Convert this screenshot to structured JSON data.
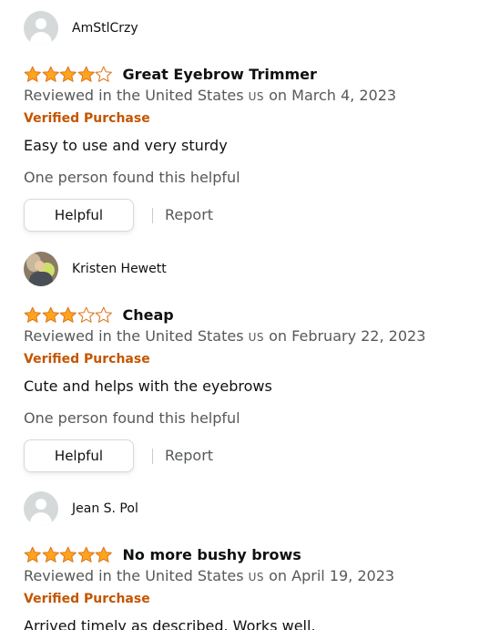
{
  "colors": {
    "star_fill": "#ffa41c",
    "star_outline": "#de7921",
    "verified": "#c45500",
    "secondary_text": "#565959",
    "primary_text": "#0f1111"
  },
  "reviews": [
    {
      "profile_name": "AmStlCrzy",
      "avatar": "default-avatar",
      "rating": 4,
      "title": "Great Eyebrow Trimmer",
      "date_prefix": "Reviewed in the United States",
      "country_code": "US",
      "date_suffix": "on March 4, 2023",
      "verified": "Verified Purchase",
      "body": "Easy to use and very sturdy",
      "helpful_count": "One person found this helpful",
      "helpful_button": "Helpful",
      "report": "Report"
    },
    {
      "profile_name": "Kristen Hewett",
      "avatar": "photo-avatar",
      "rating": 3,
      "title": "Cheap",
      "date_prefix": "Reviewed in the United States",
      "country_code": "US",
      "date_suffix": "on February 22, 2023",
      "verified": "Verified Purchase",
      "body": "Cute and helps with the eyebrows",
      "helpful_count": "One person found this helpful",
      "helpful_button": "Helpful",
      "report": "Report"
    },
    {
      "profile_name": "Jean S. Pol",
      "avatar": "default-avatar",
      "rating": 5,
      "title": "No more bushy brows",
      "date_prefix": "Reviewed in the United States",
      "country_code": "US",
      "date_suffix": "on April 19, 2023",
      "verified": "Verified Purchase",
      "body": "Arrived timely as described. Works well."
    }
  ]
}
